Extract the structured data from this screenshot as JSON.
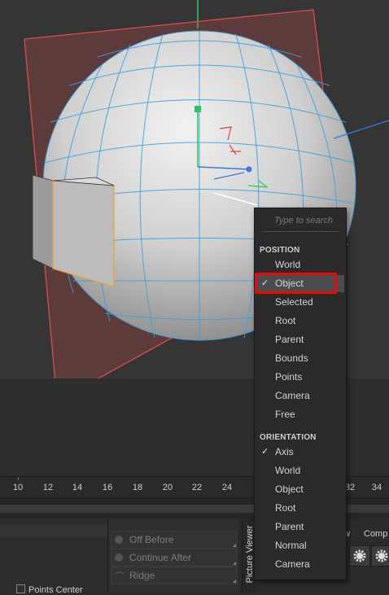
{
  "viewport": {
    "axis_colors": {
      "x": "#3c7ad0",
      "y": "#2ec45a",
      "z": "#d0463c"
    },
    "plane_color": "#c84b4b",
    "mesh_wire_color": "#3da0e0",
    "selection_color": "#f0a030"
  },
  "timeline": {
    "ticks": [
      "10",
      "12",
      "14",
      "16",
      "18",
      "20",
      "22",
      "24",
      "32",
      "34"
    ]
  },
  "attributes_panel": {
    "options": [
      "Off Before",
      "Continue After",
      "Ridge"
    ],
    "points_center": "Points Center"
  },
  "picture_viewer_tab": "Picture Viewer",
  "right_panel": {
    "tab_fragment_1": "w",
    "tab_fragment_2": "Comp"
  },
  "menu": {
    "search_placeholder": "Type to search",
    "position_heading": "POSITION",
    "position_items": [
      {
        "label": "World",
        "checked": false
      },
      {
        "label": "Object",
        "checked": true
      },
      {
        "label": "Selected",
        "checked": false
      },
      {
        "label": "Root",
        "checked": false
      },
      {
        "label": "Parent",
        "checked": false
      },
      {
        "label": "Bounds",
        "checked": false
      },
      {
        "label": "Points",
        "checked": false
      },
      {
        "label": "Camera",
        "checked": false
      },
      {
        "label": "Free",
        "checked": false
      }
    ],
    "orientation_heading": "ORIENTATION",
    "orientation_items": [
      {
        "label": "Axis",
        "checked": true
      },
      {
        "label": "World",
        "checked": false
      },
      {
        "label": "Object",
        "checked": false
      },
      {
        "label": "Root",
        "checked": false
      },
      {
        "label": "Parent",
        "checked": false
      },
      {
        "label": "Normal",
        "checked": false
      },
      {
        "label": "Camera",
        "checked": false
      }
    ],
    "check_glyph": "✓"
  }
}
